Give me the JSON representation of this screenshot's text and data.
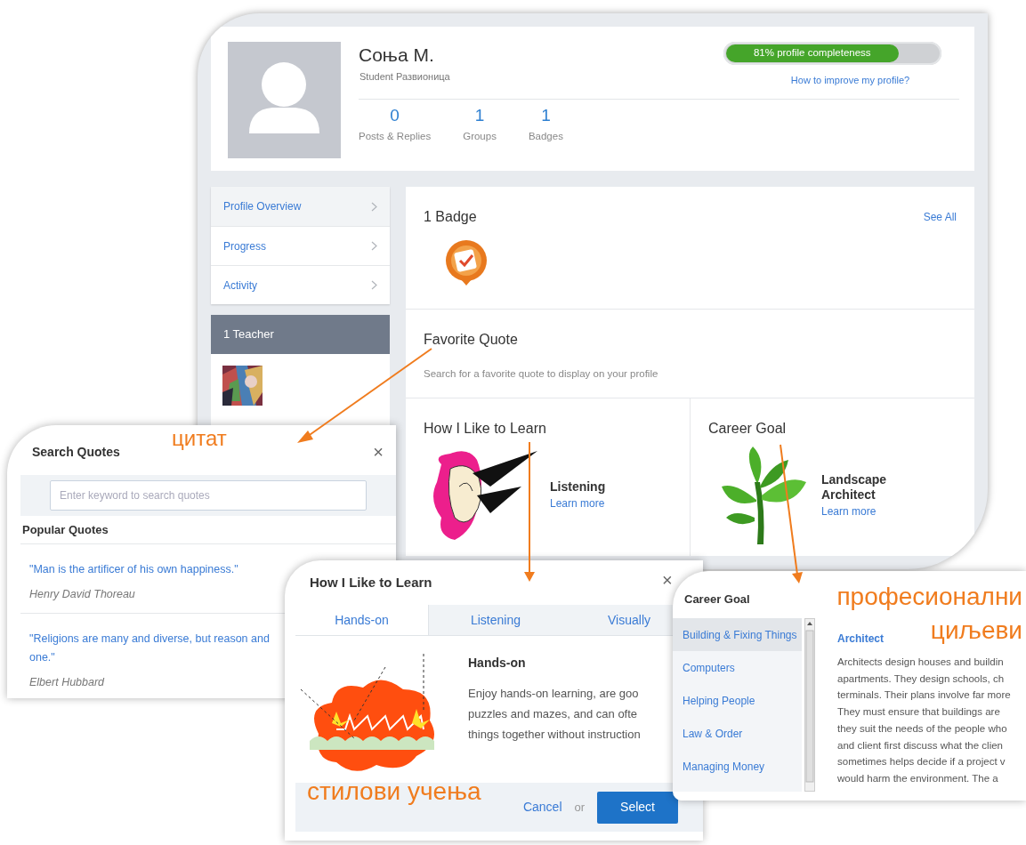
{
  "profile": {
    "name": "Соња М.",
    "subtitle": "Student Развионица",
    "completeness": {
      "label": "81% profile completeness",
      "level": 0.81
    },
    "improve_link": "How to improve my profile?",
    "stats": [
      {
        "value": "0",
        "label": "Posts & Replies"
      },
      {
        "value": "1",
        "label": "Groups"
      },
      {
        "value": "1",
        "label": "Badges"
      }
    ],
    "nav": [
      {
        "label": "Profile Overview",
        "selected": true
      },
      {
        "label": "Progress",
        "selected": false
      },
      {
        "label": "Activity",
        "selected": false
      }
    ],
    "teacher_header": "1 Teacher",
    "badges": {
      "title": "1 Badge",
      "see_all": "See All"
    },
    "favorite_quote": {
      "title": "Favorite Quote",
      "hint": "Search for a favorite quote to display on your profile"
    },
    "learn_card": {
      "title": "How I Like to Learn",
      "style": "Listening",
      "link": "Learn more"
    },
    "career_card": {
      "title": "Career Goal",
      "career": "Landscape Architect",
      "link": "Learn more"
    }
  },
  "search_quotes": {
    "title": "Search Quotes",
    "close": "×",
    "placeholder": "Enter keyword to search quotes",
    "section": "Popular Quotes",
    "quotes": [
      {
        "text": "\"Man is the artificer of his own happiness.\"",
        "author": "Henry David Thoreau"
      },
      {
        "text": "\"Religions are many and diverse, but reason and one.\"",
        "author": "Elbert Hubbard"
      }
    ]
  },
  "learn_dialog": {
    "title": "How I Like to Learn",
    "close": "×",
    "tabs": [
      {
        "label": "Hands-on",
        "selected": true
      },
      {
        "label": "Listening",
        "selected": false
      },
      {
        "label": "Visually",
        "selected": false
      }
    ],
    "heading": "Hands-on",
    "lines": [
      "Enjoy hands-on learning, are goo",
      "puzzles and mazes, and can ofte",
      "things together without instruction"
    ],
    "cancel": "Cancel",
    "or": "or",
    "select": "Select"
  },
  "career_dialog": {
    "title": "Career Goal",
    "categories": [
      {
        "label": "Building & Fixing Things",
        "selected": true
      },
      {
        "label": "Computers",
        "selected": false
      },
      {
        "label": "Helping People",
        "selected": false
      },
      {
        "label": "Law & Order",
        "selected": false
      },
      {
        "label": "Managing Money",
        "selected": false
      }
    ],
    "heading": "Architect",
    "lines": [
      "Architects design houses and buildin",
      "apartments. They design schools, ch",
      "terminals. Their plans involve far more",
      "They must ensure that buildings are",
      "they suit the needs of the people who",
      "and client first discuss what the clien",
      "sometimes helps decide if a project v",
      "would harm the environment. The a"
    ]
  },
  "annotations": {
    "quote": "цитат",
    "learn": "стилови учења",
    "career": [
      "професионални",
      "циљеви"
    ]
  }
}
